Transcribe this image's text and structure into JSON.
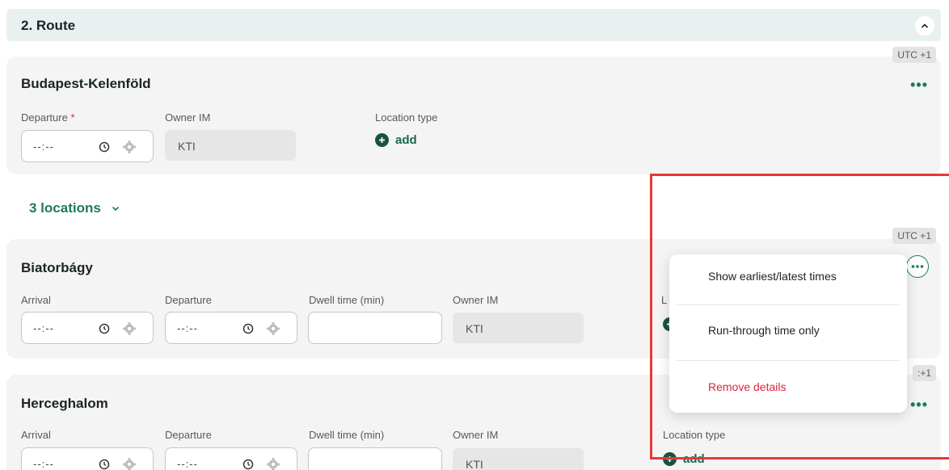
{
  "section": {
    "title": "2. Route"
  },
  "origin": {
    "utc": "UTC +1",
    "name": "Budapest-Kelenföld",
    "departure_label": "Departure",
    "required_mark": "*",
    "departure_value": "--:--",
    "owner_label": "Owner IM",
    "owner_value": "KTI",
    "location_type_label": "Location type",
    "add_label": "add"
  },
  "locations_toggle": {
    "label": "3 locations"
  },
  "stop1": {
    "utc": "UTC +1",
    "name": "Biatorbágy",
    "arrival_label": "Arrival",
    "arrival_value": "--:--",
    "departure_label": "Departure",
    "departure_value": "--:--",
    "dwell_label": "Dwell time (min)",
    "owner_label": "Owner IM",
    "owner_value": "KTI"
  },
  "stop2": {
    "name": "Herceghalom",
    "arrival_label": "Arrival",
    "arrival_value": "--:--",
    "departure_label": "Departure",
    "departure_value": "--:--",
    "dwell_label": "Dwell time (min)",
    "owner_label": "Owner IM",
    "owner_value": "KTI",
    "location_type_label": "Location type",
    "add_label": "add"
  },
  "menu": {
    "items": [
      "Show earliest/latest times",
      "Run-through time only",
      "Remove details"
    ]
  },
  "colors": {
    "accent": "#1e7a62",
    "danger": "#d9263b",
    "highlight": "#e53935",
    "header_bg": "#e8f1ef",
    "card_bg": "#f4f4f4"
  }
}
